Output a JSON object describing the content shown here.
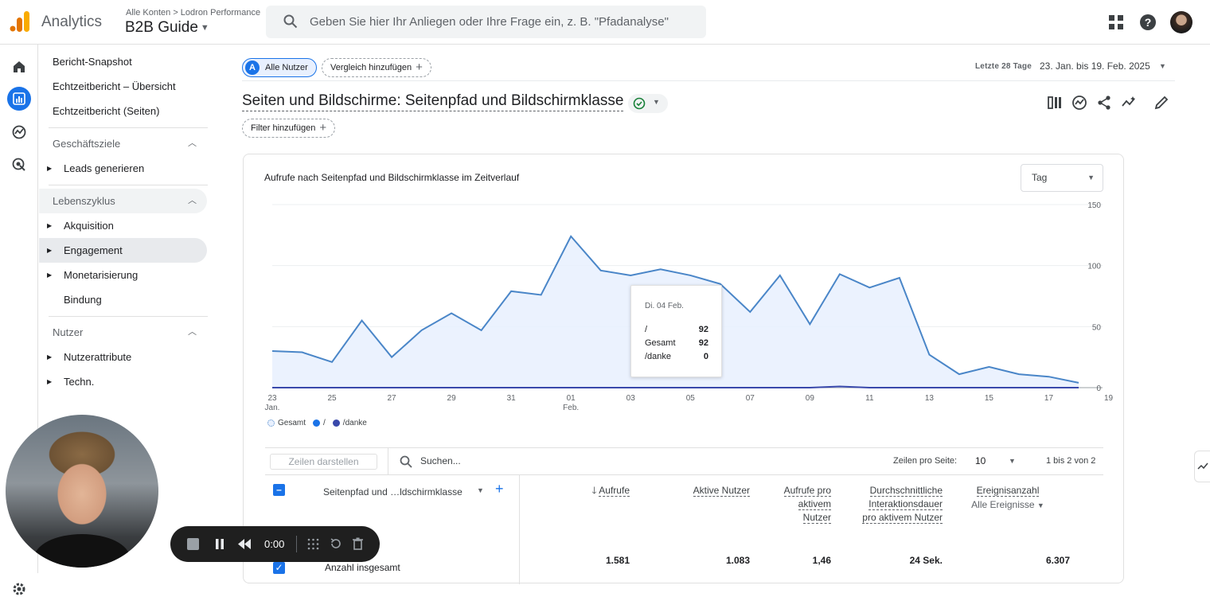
{
  "header": {
    "app_name": "Analytics",
    "breadcrumb": "Alle Konten > Lodron Performance",
    "property_name": "B2B Guide",
    "search_placeholder": "Geben Sie hier Ihr Anliegen oder Ihre Frage ein, z. B. \"Pfadanalyse\""
  },
  "sidebar": {
    "top_items": [
      "Bericht-Snapshot",
      "Echtzeitbericht – Übersicht",
      "Echtzeitbericht (Seiten)"
    ],
    "sections": [
      {
        "label": "Geschäftsziele",
        "items": [
          "Leads generieren"
        ]
      },
      {
        "label": "Lebenszyklus",
        "items": [
          "Akquisition",
          "Engagement",
          "Monetarisierung",
          "Bindung"
        ]
      },
      {
        "label": "Nutzer",
        "items": [
          "Nutzerattribute",
          "Techn."
        ]
      }
    ]
  },
  "toolbar": {
    "segment_badge": "A",
    "segment_label": "Alle Nutzer",
    "compare_label": "Vergleich hinzufügen",
    "date_label": "Letzte 28 Tage",
    "date_range": "23. Jan. bis 19. Feb. 2025",
    "report_title": "Seiten und Bildschirme: Seitenpfad und Bildschirmklasse",
    "filter_label": "Filter hinzufügen"
  },
  "chart_card": {
    "title": "Aufrufe nach Seitenpfad und Bildschirmklasse im Zeitverlauf",
    "granularity": "Tag"
  },
  "chart_data": {
    "type": "area",
    "title": "Aufrufe nach Seitenpfad und Bildschirmklasse im Zeitverlauf",
    "x_tick_labels": [
      "23",
      "25",
      "27",
      "29",
      "31",
      "01",
      "03",
      "05",
      "07",
      "09",
      "11",
      "13",
      "15",
      "17",
      "19"
    ],
    "x_month_labels": {
      "23": "Jan.",
      "01": "Feb."
    },
    "y_ticks": [
      0,
      50,
      100,
      150
    ],
    "ylim": [
      0,
      150
    ],
    "x": [
      "2025-01-23",
      "2025-01-24",
      "2025-01-25",
      "2025-01-26",
      "2025-01-27",
      "2025-01-28",
      "2025-01-29",
      "2025-01-30",
      "2025-01-31",
      "2025-02-01",
      "2025-02-02",
      "2025-02-03",
      "2025-02-04",
      "2025-02-05",
      "2025-02-06",
      "2025-02-07",
      "2025-02-08",
      "2025-02-09",
      "2025-02-10",
      "2025-02-11",
      "2025-02-12",
      "2025-02-13",
      "2025-02-14",
      "2025-02-15",
      "2025-02-16",
      "2025-02-17",
      "2025-02-18",
      "2025-02-19"
    ],
    "series": [
      {
        "name": "Gesamt",
        "color": "#4a86c8",
        "values": [
          30,
          29,
          21,
          55,
          25,
          47,
          61,
          47,
          79,
          76,
          124,
          96,
          92,
          97,
          92,
          85,
          62,
          92,
          52,
          93,
          82,
          90,
          27,
          11,
          17,
          11,
          9,
          4
        ]
      },
      {
        "name": "/",
        "color": "#1a73e8",
        "values": [
          30,
          29,
          21,
          55,
          25,
          47,
          61,
          47,
          79,
          76,
          124,
          96,
          92,
          97,
          92,
          85,
          62,
          92,
          52,
          93,
          82,
          90,
          27,
          11,
          17,
          11,
          9,
          4
        ]
      },
      {
        "name": "/danke",
        "color": "#3949ab",
        "values": [
          0,
          0,
          0,
          0,
          0,
          0,
          0,
          0,
          0,
          0,
          0,
          0,
          0,
          0,
          0,
          0,
          0,
          0,
          0,
          1,
          0,
          0,
          0,
          0,
          0,
          0,
          0,
          0
        ]
      }
    ],
    "legend": [
      "Gesamt",
      "/",
      "/danke"
    ],
    "legend_position": "bottom-left",
    "tooltip": {
      "date": "Di. 04 Feb.",
      "rows": [
        {
          "label": "/",
          "value": "92"
        },
        {
          "label": "Gesamt",
          "value": "92"
        },
        {
          "label": "/danke",
          "value": "0"
        }
      ]
    }
  },
  "table": {
    "rows_button": "Zeilen darstellen",
    "search_placeholder": "Suchen...",
    "per_page_label": "Zeilen pro Seite:",
    "per_page_value": "10",
    "pagination": "1 bis 2 von 2",
    "dimension_header": "Seitenpfad und …ldschirmklasse",
    "columns": [
      {
        "label": "Aufrufe",
        "sorted": true
      },
      {
        "label": "Aktive Nutzer"
      },
      {
        "label": "Aufrufe pro aktivem Nutzer"
      },
      {
        "label": "Durchschnittliche Interaktionsdauer pro aktivem Nutzer"
      },
      {
        "label": "Ereignisanzahl",
        "sub": "Alle Ereignisse"
      }
    ],
    "total_label": "Anzahl insgesamt",
    "totals": [
      "1.581",
      "1.083",
      "1,46",
      "24 Sek.",
      "6.307"
    ]
  },
  "recorder": {
    "time": "0:00"
  }
}
